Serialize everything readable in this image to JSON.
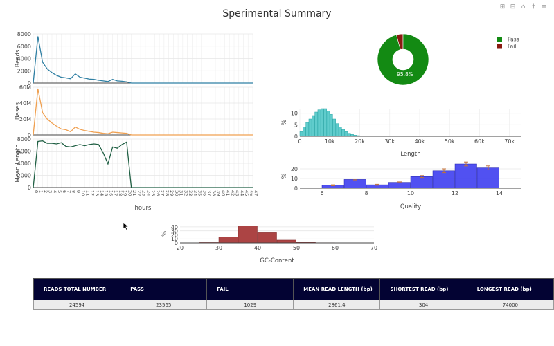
{
  "title": "Sperimental Summary",
  "toolbar": {
    "icons": [
      "zoom-in-icon",
      "zoom-out-icon",
      "home-icon",
      "spike-icon",
      "compare-icon"
    ],
    "color": "#999999"
  },
  "colors": {
    "reads": "#2f7fa3",
    "bases": "#f0a050",
    "mean_length": "#1f5f43",
    "pass": "#138a13",
    "fail": "#8a1a10",
    "length_hist": "#4fc6c6",
    "quality_hist": "#3333ee",
    "error_bar": "#c0703a",
    "gc_hist": "#a83a3a"
  },
  "chart_data": [
    {
      "type": "line",
      "panel": "reads",
      "x": [
        0,
        1,
        2,
        3,
        4,
        5,
        6,
        7,
        8,
        9,
        10,
        11,
        12,
        13,
        14,
        15,
        16,
        17,
        18,
        19,
        20,
        21,
        22,
        47
      ],
      "values": [
        0,
        7600,
        3400,
        2300,
        1700,
        1250,
        950,
        850,
        700,
        1500,
        950,
        800,
        650,
        600,
        450,
        350,
        250,
        600,
        350,
        300,
        200,
        0,
        0,
        0
      ],
      "ylabel": "Reads",
      "ylim": [
        0,
        8000
      ],
      "yticks": [
        "0",
        "2000",
        "4000",
        "6000",
        "8000"
      ]
    },
    {
      "type": "line",
      "panel": "bases",
      "x": [
        0,
        1,
        2,
        3,
        4,
        5,
        6,
        7,
        8,
        9,
        10,
        11,
        12,
        13,
        14,
        15,
        16,
        17,
        18,
        19,
        20,
        21,
        22,
        47
      ],
      "values": [
        0,
        58,
        28,
        20,
        15,
        11,
        7.5,
        6.5,
        4,
        10,
        7,
        5.5,
        4.5,
        3.5,
        3,
        2,
        1.5,
        3.5,
        3,
        2.5,
        2,
        0,
        0,
        0
      ],
      "ylabel": "Bases",
      "ylim": [
        0,
        60
      ],
      "yticks": [
        "0",
        "20M",
        "40M",
        "60M"
      ]
    },
    {
      "type": "line",
      "panel": "mean_length",
      "x": [
        0,
        1,
        2,
        3,
        4,
        5,
        6,
        7,
        8,
        9,
        10,
        11,
        12,
        13,
        14,
        15,
        16,
        17,
        18,
        19,
        20,
        21,
        22,
        47
      ],
      "values": [
        0,
        7600,
        7700,
        7300,
        7300,
        7200,
        7400,
        6800,
        6700,
        6900,
        7100,
        6900,
        7100,
        7200,
        7100,
        5700,
        3900,
        6700,
        6500,
        7100,
        7500,
        0,
        0,
        0
      ],
      "ylabel": "Mean Length",
      "ylim": [
        0,
        8000
      ],
      "yticks": [
        "0",
        "2000",
        "4000",
        "6000",
        "8000"
      ],
      "xlabel": "hours",
      "xticks": [
        "0",
        "1",
        "2",
        "3",
        "4",
        "5",
        "6",
        "7",
        "8",
        "9",
        "10",
        "11",
        "12",
        "13",
        "14",
        "15",
        "16",
        "17",
        "18",
        "19",
        "20",
        "21",
        "22",
        "23",
        "24",
        "25",
        "26",
        "27",
        "28",
        "29",
        "30",
        "31",
        "32",
        "33",
        "34",
        "35",
        "36",
        "37",
        "38",
        "39",
        "40",
        "41",
        "42",
        "43",
        "44",
        "45",
        "46",
        "47"
      ]
    },
    {
      "type": "pie",
      "panel": "pass_fail",
      "labels": [
        "Pass",
        "Fail"
      ],
      "values": [
        23565,
        1029
      ],
      "slice_label": "95.8%",
      "legend": "top-right"
    },
    {
      "type": "bar",
      "panel": "length_hist",
      "x_start": 0,
      "bin_width": 1000,
      "values": [
        2,
        4,
        6,
        7.5,
        9,
        10.5,
        11.5,
        12,
        12,
        11,
        9.5,
        7.5,
        5.5,
        4,
        3,
        2,
        1.3,
        0.8,
        0.5,
        0.3,
        0.2,
        0.15,
        0.1,
        0.1,
        0.05,
        0.05
      ],
      "xlabel": "Length",
      "ylabel": "%",
      "xlim": [
        0,
        74000
      ],
      "ylim": [
        0,
        12
      ],
      "xticks": [
        "0",
        "10k",
        "20k",
        "30k",
        "40k",
        "50k",
        "60k",
        "70k"
      ],
      "yticks": [
        "0",
        "5",
        "10"
      ]
    },
    {
      "type": "bar",
      "panel": "quality_hist",
      "x_start": 6,
      "bin_width": 1,
      "values": [
        3,
        9,
        3.5,
        6,
        12,
        18,
        25,
        21
      ],
      "errors": [
        0.5,
        0.5,
        0.5,
        0.5,
        1,
        2,
        2,
        2
      ],
      "xlabel": "Quality",
      "ylabel": "%",
      "xlim": [
        5,
        15
      ],
      "ylim": [
        0,
        25
      ],
      "xticks": [
        "6",
        "8",
        "10",
        "12",
        "14"
      ],
      "yticks": [
        "0",
        "10",
        "20"
      ]
    },
    {
      "type": "bar",
      "panel": "gc_hist",
      "x_start": 25,
      "bin_width": 5,
      "values": [
        1,
        15,
        42,
        27,
        7,
        1.5,
        0.5
      ],
      "xlabel": "GC-Content",
      "ylabel": "%",
      "xlim": [
        20,
        70
      ],
      "ylim": [
        0,
        45
      ],
      "xticks": [
        "20",
        "30",
        "40",
        "50",
        "60",
        "70"
      ],
      "yticks": [
        "0",
        "10",
        "20",
        "30",
        "40"
      ]
    }
  ],
  "table": {
    "headers": [
      "READS TOTAL NUMBER",
      "PASS",
      "FAIL",
      "MEAN READ LENGTH (bp)",
      "SHORTEST READ (bp)",
      "LONGEST READ (bp)"
    ],
    "values": [
      "24594",
      "23565",
      "1029",
      "2861.4",
      "304",
      "74000"
    ]
  }
}
